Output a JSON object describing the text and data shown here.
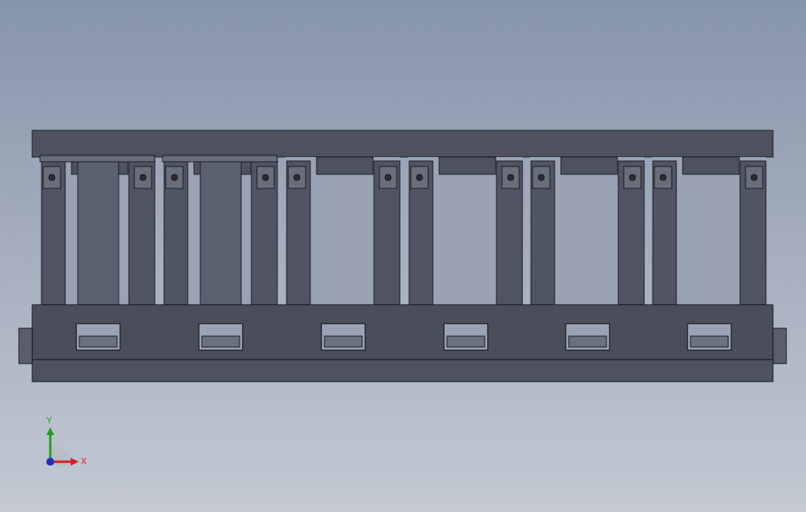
{
  "triad": {
    "axes": [
      {
        "kind": "y",
        "label": "Y",
        "color": "#20a020"
      },
      {
        "kind": "x",
        "label": "X",
        "color": "#d02020"
      }
    ]
  }
}
